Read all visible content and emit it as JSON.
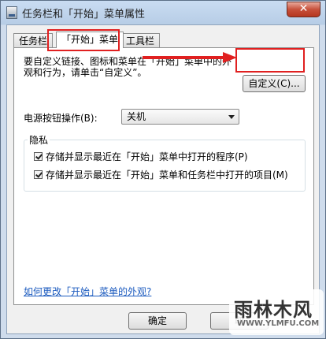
{
  "window": {
    "title": "任务栏和「开始」菜单属性",
    "close_label": "✕"
  },
  "tabs": [
    {
      "label": "任务栏"
    },
    {
      "label": "「开始」菜单"
    },
    {
      "label": "工具栏"
    }
  ],
  "main": {
    "description": "要自定义链接、图标和菜单在「开始」菜单中的外观和行为，请单击“自定义”。",
    "customize_button": "自定义(C)...",
    "power_label": "电源按钮操作(B):",
    "power_selected": "关机",
    "privacy": {
      "title": "隐私",
      "items": [
        {
          "label": "存储并显示最近在「开始」菜单中打开的程序(P)"
        },
        {
          "label": "存储并显示最近在「开始」菜单和任务栏中打开的项目(M)"
        }
      ]
    },
    "help_link": "如何更改「开始」菜单的外观?"
  },
  "footer": {
    "ok_button": "确定",
    "next_button": "取"
  },
  "watermark": {
    "main": "雨林木风",
    "sub": "WWW.YLMFU.COM"
  },
  "colors": {
    "highlight": "#e02020",
    "link": "#1c5bbf"
  }
}
